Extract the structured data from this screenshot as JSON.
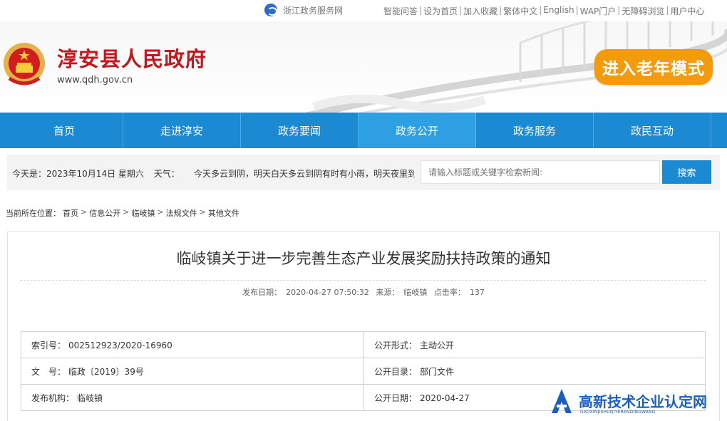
{
  "topbar": {
    "zj_link": "浙江政务服务网",
    "links": [
      "智能问答",
      "设为首页",
      "加入收藏",
      "繁体中文",
      "English",
      "WAP门户",
      "无障碍浏览",
      "用户中心"
    ]
  },
  "header": {
    "site_title": "淳安县人民政府",
    "site_url": "www.qdh.gov.cn",
    "elder_mode": "进入老年模式"
  },
  "nav": {
    "items": [
      "首页",
      "走进淳安",
      "政务要闻",
      "政务公开",
      "政务服务",
      "政民互动"
    ],
    "active_index": 3
  },
  "infobar": {
    "today": "今天是：2023年10月14日 星期六",
    "weather_label": "天气：",
    "weather_text": "今天多云到阴，明天白天多云到阴有时有小雨，明天夜里到",
    "search_placeholder": "请输入标题或关键字检索新闻:",
    "search_button": "搜索"
  },
  "breadcrumb": {
    "prefix": "当前所在位置：",
    "items": [
      "首页",
      "信息公开",
      "临岐镇",
      "法规文件",
      "其他文件"
    ]
  },
  "article": {
    "title": "临岐镇关于进一步完善生态产业发展奖励扶持政策的通知",
    "publish_label": "发布日期：",
    "publish_date": "2020-04-27 07:50:32",
    "source_label": "来源：",
    "source": "临岐镇",
    "hits_label": "点击率：",
    "hits": "137"
  },
  "info_table": {
    "index_label": "索引号：",
    "index_value": "002512923/2020-16960",
    "form_label": "公开形式：",
    "form_value": "主动公开",
    "doc_label": "文　号：",
    "doc_value": "临政〔2019〕39号",
    "dir_label": "公开目录：",
    "dir_value": "部门文件",
    "org_label": "发布机构：",
    "org_value": "临岐镇",
    "date_label": "公开日期：",
    "date_value": "2020-04-27"
  },
  "watermark": {
    "text": "高新技术企业认定网",
    "sub": "GAOXINJISHUQIYERENDINGWANG"
  },
  "colors": {
    "nav_blue": "#1b8ad2",
    "title_red": "#c4161c",
    "elder_orange": "#f39a0d"
  }
}
